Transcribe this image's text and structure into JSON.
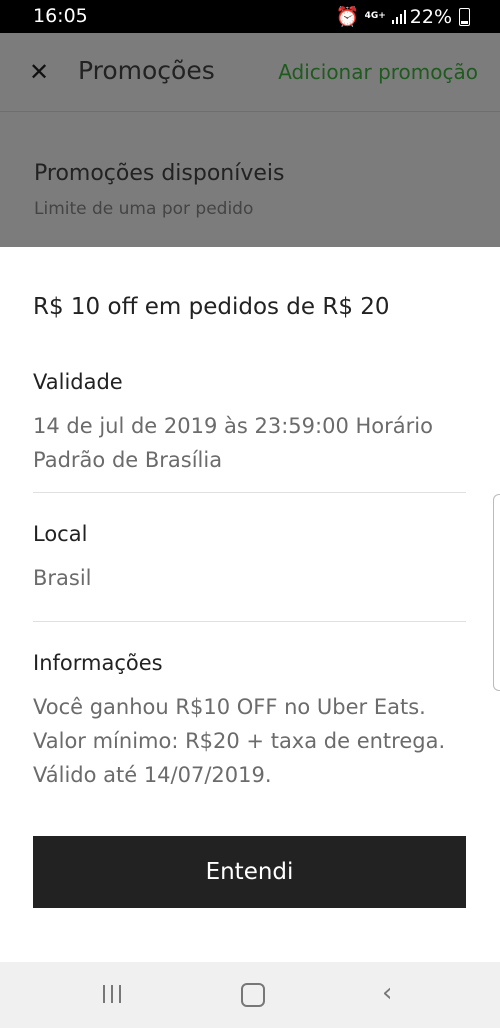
{
  "status_bar": {
    "time": "16:05",
    "network": "4G+",
    "battery": "22%",
    "icons": [
      "alarm-icon",
      "network-4g-icon",
      "signal-icon",
      "battery-icon"
    ]
  },
  "background_page": {
    "title": "Promoções",
    "add_promo_label": "Adicionar promoção",
    "section_title": "Promoções disponíveis",
    "section_subtitle": "Limite de uma por pedido",
    "close_icon": "close-icon"
  },
  "sheet": {
    "headline": "R$ 10 off em pedidos de R$ 20",
    "validity_label": "Validade",
    "validity_value": "14 de jul de 2019 às 23:59:00 Horário Padrão de Brasília",
    "local_label": "Local",
    "local_value": "Brasil",
    "info_label": "Informações",
    "info_lines": [
      "Você ganhou R$10 OFF no Uber Eats.",
      "Valor mínimo: R$20 + taxa de entrega.",
      "Válido até 14/07/2019."
    ],
    "button_label": "Entendi"
  },
  "colors": {
    "accent_green": "#1f5a1f",
    "button_bg": "#222222",
    "overlay_gray": "#7c7c7c"
  }
}
